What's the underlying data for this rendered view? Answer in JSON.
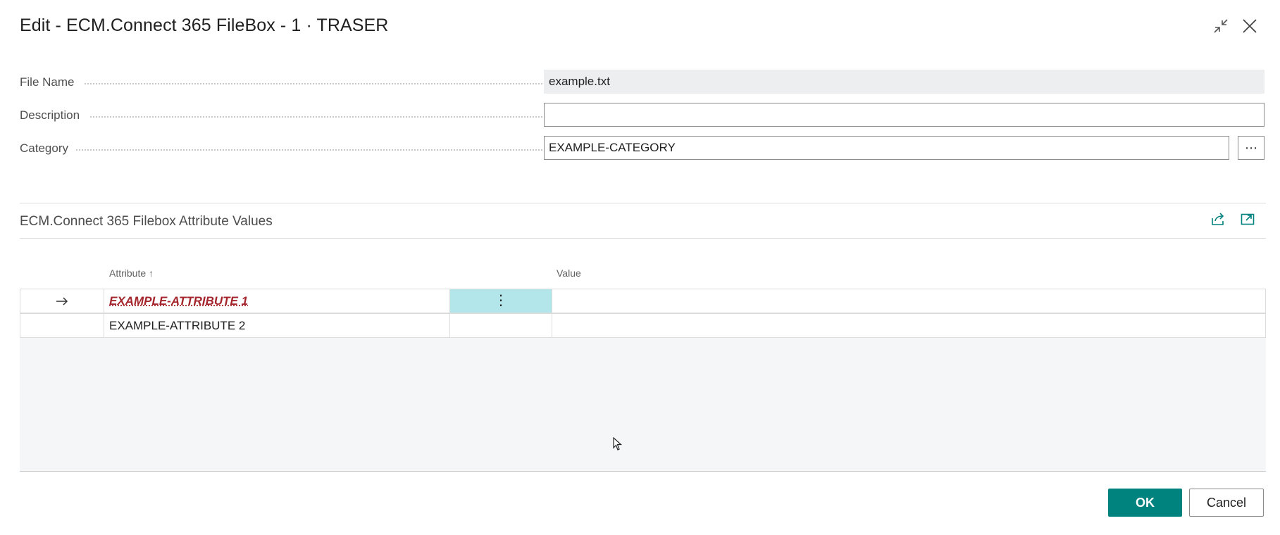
{
  "dialog": {
    "title": "Edit - ECM.Connect 365 FileBox - 1 · TRASER"
  },
  "fields": {
    "file_name": {
      "label": "File Name",
      "value": "example.txt"
    },
    "description": {
      "label": "Description",
      "value": ""
    },
    "category": {
      "label": "Category",
      "value": "EXAMPLE-CATEGORY",
      "assist": "⋯"
    }
  },
  "part": {
    "title": "ECM.Connect 365 Filebox Attribute Values",
    "columns": {
      "attribute": "Attribute",
      "sort_indicator": "↑",
      "value": "Value"
    },
    "rows": [
      {
        "attribute": "EXAMPLE-ATTRIBUTE 1",
        "value": "",
        "menu": "⋮",
        "current": true,
        "error": true
      },
      {
        "attribute": "EXAMPLE-ATTRIBUTE 2",
        "value": "",
        "current": false,
        "error": false
      }
    ]
  },
  "footer": {
    "ok_label": "OK",
    "cancel_label": "Cancel"
  },
  "colors": {
    "accent": "#00827f",
    "error": "#a4262c",
    "selected_cell": "#b3e6ea"
  }
}
